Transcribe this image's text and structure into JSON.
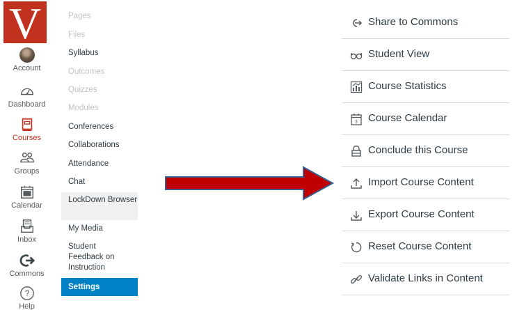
{
  "global_nav": {
    "logo_letter": "V",
    "logo_color": "#c0311e",
    "items": [
      {
        "label": "Account",
        "icon": "avatar"
      },
      {
        "label": "Dashboard",
        "icon": "dashboard-icon"
      },
      {
        "label": "Courses",
        "icon": "courses-icon",
        "active": true
      },
      {
        "label": "Groups",
        "icon": "groups-icon"
      },
      {
        "label": "Calendar",
        "icon": "calendar-icon"
      },
      {
        "label": "Inbox",
        "icon": "inbox-icon"
      },
      {
        "label": "Commons",
        "icon": "commons-icon"
      },
      {
        "label": "Help",
        "icon": "help-icon"
      }
    ]
  },
  "course_nav": {
    "items": [
      {
        "label": "Pages",
        "disabled": true
      },
      {
        "label": "Files",
        "disabled": true
      },
      {
        "label": "Syllabus",
        "disabled": false
      },
      {
        "label": "Outcomes",
        "disabled": true
      },
      {
        "label": "Quizzes",
        "disabled": true
      },
      {
        "label": "Modules",
        "disabled": true
      },
      {
        "label": "Conferences",
        "disabled": false
      },
      {
        "label": "Collaborations",
        "disabled": false
      },
      {
        "label": "Attendance",
        "disabled": false
      },
      {
        "label": "Chat",
        "disabled": false
      },
      {
        "label": "LockDown Browser",
        "disabled": false
      },
      {
        "label": "My Media",
        "disabled": false
      },
      {
        "label": "Student Feedback on Instruction",
        "disabled": false
      },
      {
        "label": "Settings",
        "active": true
      }
    ]
  },
  "right_sidebar": {
    "items": [
      {
        "label": "Share to Commons",
        "icon": "share-commons-icon"
      },
      {
        "label": "Student View",
        "icon": "glasses-icon"
      },
      {
        "label": "Course Statistics",
        "icon": "statistics-icon"
      },
      {
        "label": "Course Calendar",
        "icon": "calendar-icon"
      },
      {
        "label": "Conclude this Course",
        "icon": "lock-icon"
      },
      {
        "label": "Import Course Content",
        "icon": "upload-icon"
      },
      {
        "label": "Export Course Content",
        "icon": "download-icon"
      },
      {
        "label": "Reset Course Content",
        "icon": "reset-icon"
      },
      {
        "label": "Validate Links in Content",
        "icon": "link-icon"
      }
    ]
  },
  "annotation": {
    "arrow_color": "#c00000",
    "arrow_border": "#3a5f8f"
  }
}
